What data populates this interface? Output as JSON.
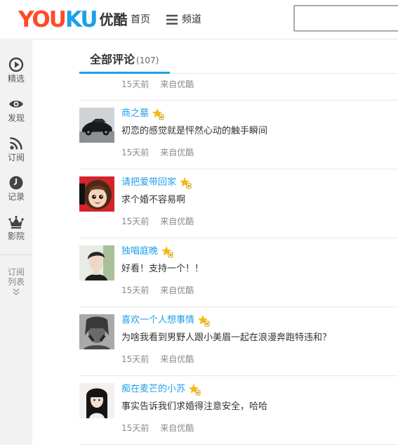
{
  "header": {
    "logo_latin_you": "YOU",
    "logo_latin_ku": "KU",
    "logo_cn": "优酷",
    "nav_home": "首页",
    "nav_channel": "频道",
    "search_value": ""
  },
  "sidebar": {
    "items": [
      {
        "label": "精选",
        "icon": "play-circle-icon"
      },
      {
        "label": "发现",
        "icon": "eye-icon"
      },
      {
        "label": "订阅",
        "icon": "rss-icon"
      },
      {
        "label": "记录",
        "icon": "clock-icon"
      },
      {
        "label": "影院",
        "icon": "crown-icon"
      }
    ],
    "sub_label_line1": "订阅",
    "sub_label_line2": "列表"
  },
  "tabs": {
    "active_label": "全部评论",
    "active_count": "(107)"
  },
  "first_meta": {
    "time": "15天前",
    "source": "来自优酷"
  },
  "comments": [
    {
      "username": "商之墓",
      "text": "初恋的感觉就是怦然心动的触手瞬间",
      "time": "15天前",
      "source": "来自优酷",
      "avatar": "car-avatar"
    },
    {
      "username": "请把爱带回家",
      "text": "求个婚不容易啊",
      "time": "15天前",
      "source": "来自优酷",
      "avatar": "cartoon-girl-avatar"
    },
    {
      "username": "独唱庭晚",
      "text": "好看！支持一个！！",
      "time": "15天前",
      "source": "来自优酷",
      "avatar": "young-man-avatar"
    },
    {
      "username": "喜欢一个人想事情",
      "text": "为啥我看到男野人跟小美眉一起在浪漫奔跑特违和？",
      "time": "15天前",
      "source": "来自优酷",
      "avatar": "bw-face-avatar"
    },
    {
      "username": "痴在麦芒的小苏",
      "text": "事实告诉我们求婚得注意安全，哈哈",
      "time": "15天前",
      "source": "来自优酷",
      "avatar": "girl-avatar"
    }
  ],
  "colors": {
    "accent": "#1e9fe9",
    "logo_red": "#ff4a2a",
    "vip_gold": "#f5b80f",
    "meta_gray": "#8a8a8a"
  }
}
